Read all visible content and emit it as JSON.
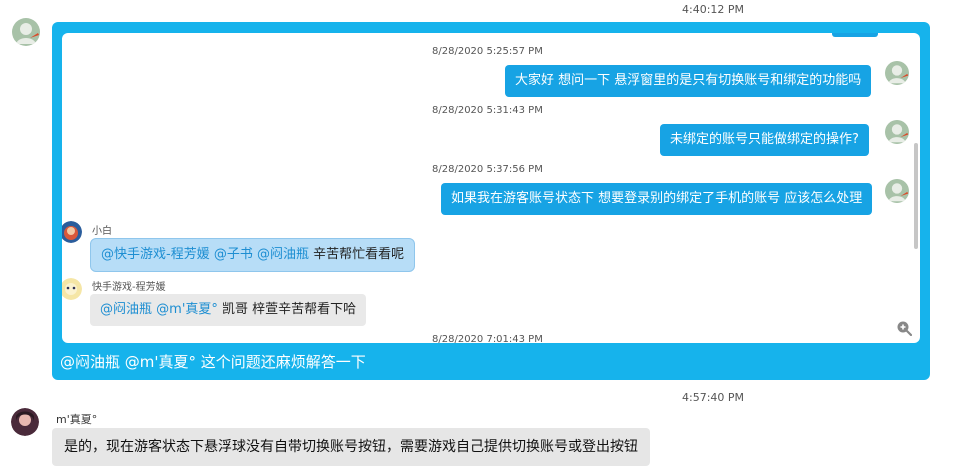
{
  "chat": {
    "top_timestamp": "4:40:12 PM",
    "quote": {
      "messages": [
        {
          "timestamp": "8/28/2020 5:25:57 PM",
          "text": "大家好 想问一下 悬浮窗里的是只有切换账号和绑定的功能吗"
        },
        {
          "timestamp": "8/28/2020 5:31:43 PM",
          "text": "未绑定的账号只能做绑定的操作?"
        },
        {
          "timestamp": "8/28/2020 5:37:56 PM",
          "text": "如果我在游客账号状态下 想要登录别的绑定了手机的账号 应该怎么处理"
        }
      ],
      "xiaobai": {
        "name": "小白",
        "mentions": [
          "@快手游戏-程芳媛",
          "@子书",
          "@闷油瓶"
        ],
        "text": "辛苦帮忙看看呢"
      },
      "kuaishou": {
        "name": "快手游戏-程芳媛",
        "mentions": [
          "@闷油瓶",
          "@m'真夏°"
        ],
        "text": "凯哥 梓萱辛苦帮看下哈"
      },
      "partial_timestamp": "8/28/2020 7:01:43 PM",
      "footer": "@闷油瓶 @m'真夏° 这个问题还麻烦解答一下"
    },
    "mid_timestamp": "4:57:40 PM",
    "reply": {
      "sender": "m'真夏°",
      "text": "是的，现在游客状态下悬浮球没有自带切换账号按钮，需要游戏自己提供切换账号或登出按钮"
    }
  }
}
